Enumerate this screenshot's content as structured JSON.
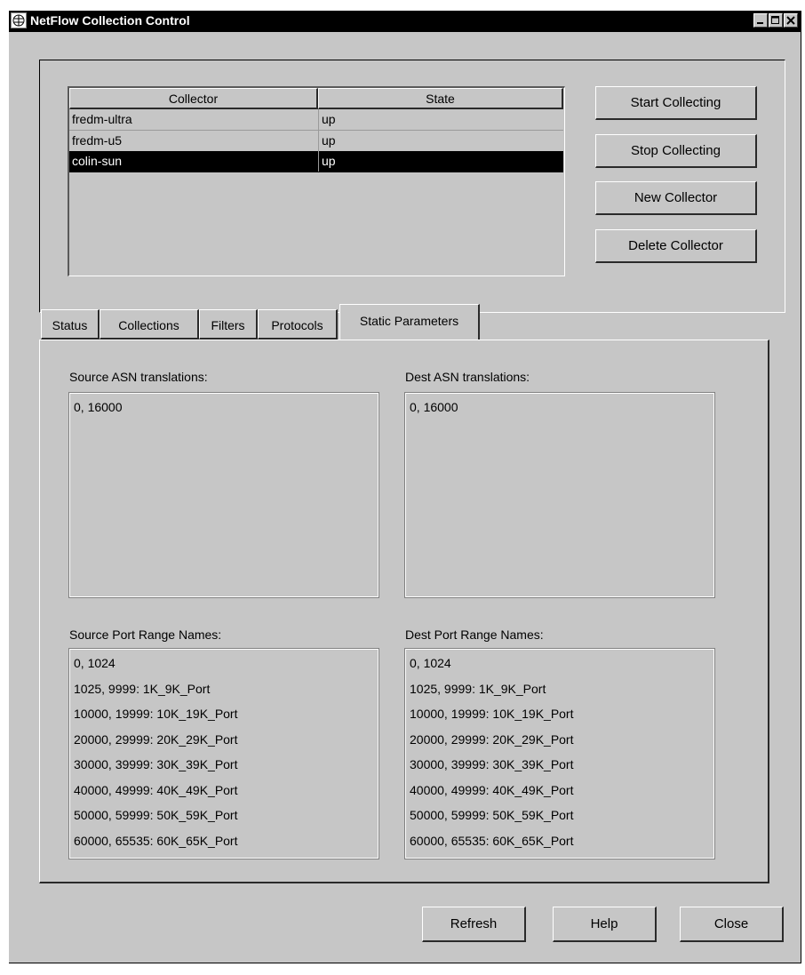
{
  "window": {
    "title": "NetFlow Collection Control",
    "icon": "app-icon"
  },
  "collector_table": {
    "headers": {
      "collector": "Collector",
      "state": "State"
    },
    "rows": [
      {
        "collector": "fredm-ultra",
        "state": "up",
        "selected": false
      },
      {
        "collector": "fredm-u5",
        "state": "up",
        "selected": false
      },
      {
        "collector": "colin-sun",
        "state": "up",
        "selected": true
      }
    ]
  },
  "actions": {
    "start": "Start Collecting",
    "stop": "Stop Collecting",
    "new": "New Collector",
    "delete": "Delete Collector"
  },
  "tabs": [
    {
      "label": "Status",
      "active": false
    },
    {
      "label": "Collections",
      "active": false
    },
    {
      "label": "Filters",
      "active": false
    },
    {
      "label": "Protocols",
      "active": false
    },
    {
      "label": "Static Parameters",
      "active": true
    }
  ],
  "static_parameters": {
    "source_asn": {
      "label": "Source ASN translations:",
      "lines": [
        "0, 16000"
      ]
    },
    "dest_asn": {
      "label": "Dest ASN translations:",
      "lines": [
        "0, 16000"
      ]
    },
    "source_port": {
      "label": "Source Port Range Names:",
      "lines": [
        "0, 1024",
        "1025, 9999: 1K_9K_Port",
        "10000, 19999: 10K_19K_Port",
        "20000, 29999: 20K_29K_Port",
        "30000, 39999: 30K_39K_Port",
        "40000, 49999: 40K_49K_Port",
        "50000, 59999: 50K_59K_Port",
        "60000, 65535: 60K_65K_Port"
      ]
    },
    "dest_port": {
      "label": "Dest Port Range Names:",
      "lines": [
        "0, 1024",
        "1025, 9999: 1K_9K_Port",
        "10000, 19999: 10K_19K_Port",
        "20000, 29999: 20K_29K_Port",
        "30000, 39999: 30K_39K_Port",
        "40000, 49999: 40K_49K_Port",
        "50000, 59999: 50K_59K_Port",
        "60000, 65535: 60K_65K_Port"
      ]
    }
  },
  "footer": {
    "refresh": "Refresh",
    "help": "Help",
    "close": "Close"
  },
  "colors": {
    "face": "#c6c6c6",
    "titlebar": "#000000",
    "selection": "#000000",
    "selection_text": "#ffffff"
  }
}
